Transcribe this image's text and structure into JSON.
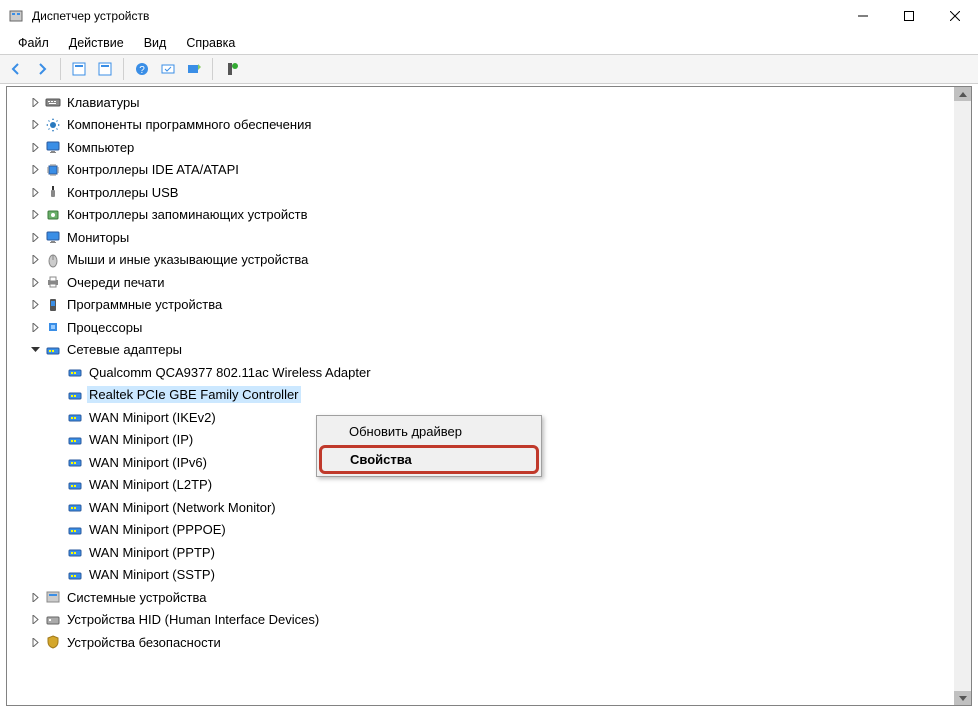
{
  "window": {
    "title": "Диспетчер устройств"
  },
  "menubar": {
    "file": "Файл",
    "action": "Действие",
    "view": "Вид",
    "help": "Справка"
  },
  "categories": {
    "keyboards": "Клавиатуры",
    "software_components": "Компоненты программного обеспечения",
    "computer": "Компьютер",
    "ide_atapi": "Контроллеры IDE ATA/ATAPI",
    "usb": "Контроллеры USB",
    "storage": "Контроллеры запоминающих устройств",
    "monitors": "Мониторы",
    "mice": "Мыши и иные указывающие устройства",
    "print_queues": "Очереди печати",
    "software_devices": "Программные устройства",
    "processors": "Процессоры",
    "network_adapters": "Сетевые адаптеры",
    "system_devices": "Системные устройства",
    "hid": "Устройства HID (Human Interface Devices)",
    "security": "Устройства безопасности"
  },
  "network_children": {
    "qualcomm": "Qualcomm QCA9377 802.11ac Wireless Adapter",
    "realtek": "Realtek PCIe GBE Family Controller",
    "wan_ikev2": "WAN Miniport (IKEv2)",
    "wan_ip": "WAN Miniport (IP)",
    "wan_ipv6": "WAN Miniport (IPv6)",
    "wan_l2tp": "WAN Miniport (L2TP)",
    "wan_netmon": "WAN Miniport (Network Monitor)",
    "wan_pppoe": "WAN Miniport (PPPOE)",
    "wan_pptp": "WAN Miniport (PPTP)",
    "wan_sstp": "WAN Miniport (SSTP)"
  },
  "context_menu": {
    "update_driver": "Обновить драйвер",
    "properties": "Свойства"
  }
}
